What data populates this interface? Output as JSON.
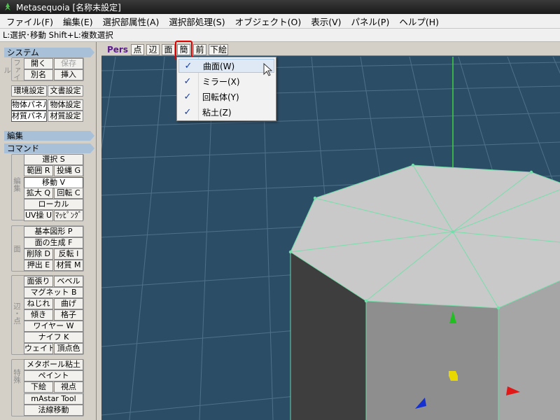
{
  "window": {
    "title": "Metasequoia [名称未設定]"
  },
  "menu": [
    "ファイル(F)",
    "編集(E)",
    "選択部属性(A)",
    "選択部処理(S)",
    "オブジェクト(O)",
    "表示(V)",
    "パネル(P)",
    "ヘルプ(H)"
  ],
  "hint": "L:選択･移動  Shift+L:複数選択",
  "left_panel": {
    "system": {
      "header": "システム",
      "file_label": "ファイル",
      "open": "開く",
      "save": "保存",
      "save_as": "別名",
      "insert": "挿入",
      "env_settings": "環境設定",
      "doc_settings": "文書設定",
      "object_panel": "物体パネル",
      "object_settings": "物体設定",
      "material_panel": "材質パネル",
      "material_settings": "材質設定"
    },
    "edit": {
      "header": "編集"
    },
    "command": {
      "header": "コマンド",
      "edit_label": "編集",
      "select": "選択 S",
      "range": "範囲 R",
      "lasso": "投縄 G",
      "move": "移動 V",
      "scale": "拡大 Q",
      "rotate": "回転 C",
      "local": "ローカル",
      "uv": "UV操 U",
      "mapping": "ﾏｯﾋﾟﾝｸﾞ",
      "face_label": "面",
      "primitive": "基本図形 P",
      "create_face": "面の生成 F",
      "delete": "削除 D",
      "flip": "反転 I",
      "extrude": "押出 E",
      "material": "材質 M",
      "edge_vertex_label": "辺・点",
      "face_stretch": "面張り",
      "bevel": "ベベル",
      "magnet": "マグネット B",
      "twist": "ねじれ",
      "bend": "曲げ",
      "tilt": "傾き",
      "lattice": "格子",
      "wire": "ワイヤー W",
      "knife": "ナイフ K",
      "weight": "ウェイト",
      "vertex_color": "頂点色",
      "special_label": "特殊",
      "metaball": "メタボール粘土",
      "paint": "ペイント",
      "underlay": "下絵",
      "viewpoint": "視点",
      "mastar": "mAstar Tool",
      "normal_move": "法線移動"
    }
  },
  "viewport": {
    "mode": "Pers",
    "buttons": [
      "点",
      "辺",
      "面",
      "簡",
      "前",
      "下絵"
    ],
    "active_button": "簡"
  },
  "dropdown": {
    "items": [
      {
        "label": "曲面(W)",
        "checked": "✓"
      },
      {
        "label": "ミラー(X)",
        "checked": "✓"
      },
      {
        "label": "回転体(Y)",
        "checked": "✓"
      },
      {
        "label": "粘土(Z)",
        "checked": "✓"
      }
    ]
  },
  "colors": {
    "viewport_bg": "#2c4d66",
    "grid": "#5a7d96",
    "mesh_top": "#c8c8c8",
    "edge_highlight": "#70e0a8",
    "highlight_box": "#e00000"
  }
}
